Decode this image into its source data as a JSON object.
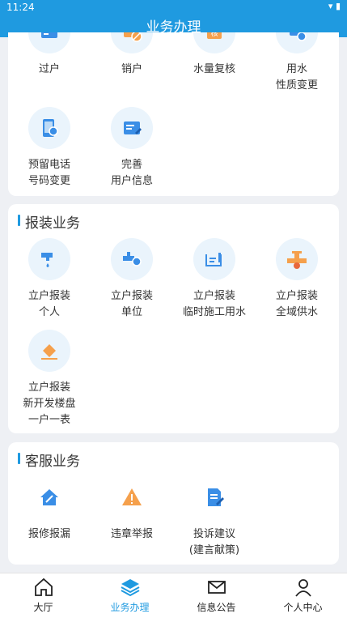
{
  "status_bar": {
    "time": "11:24",
    "wifi_icon": "wifi-icon",
    "battery_icon": "battery-icon"
  },
  "header": {
    "title": "业务办理"
  },
  "account_section": {
    "items": [
      {
        "label": "过户",
        "icon": "card-icon"
      },
      {
        "label": "销户",
        "icon": "cancel-account-icon"
      },
      {
        "label": "水量复核",
        "icon": "review-icon"
      },
      {
        "label": "用水\n性质变更",
        "icon": "tap-change-icon"
      },
      {
        "label": "预留电话\n号码变更",
        "icon": "phone-icon"
      },
      {
        "label": "完善\n用户信息",
        "icon": "user-info-icon"
      }
    ]
  },
  "install_section": {
    "title": "报装业务",
    "items": [
      {
        "label": "立户报装\n个人",
        "icon": "faucet-icon"
      },
      {
        "label": "立户报装\n单位",
        "icon": "pipe-icon"
      },
      {
        "label": "立户报装\n临时施工用水",
        "icon": "construction-icon"
      },
      {
        "label": "立户报装\n全域供水",
        "icon": "valve-icon"
      },
      {
        "label": "立户报装\n新开发楼盘\n一户一表",
        "icon": "edit-building-icon"
      }
    ]
  },
  "service_section": {
    "title": "客服业务",
    "items": [
      {
        "label": "报修报漏",
        "icon": "repair-icon"
      },
      {
        "label": "违章举报",
        "icon": "warning-icon"
      },
      {
        "label": "投诉建议\n(建言献策)",
        "icon": "complaint-icon"
      }
    ]
  },
  "tabbar": {
    "tabs": [
      {
        "label": "大厅",
        "icon": "home-icon",
        "active": false
      },
      {
        "label": "业务办理",
        "icon": "layers-icon",
        "active": true
      },
      {
        "label": "信息公告",
        "icon": "mail-icon",
        "active": false
      },
      {
        "label": "个人中心",
        "icon": "user-icon",
        "active": false
      }
    ]
  },
  "colors": {
    "accent": "#1f9ae0",
    "icon_blue": "#3a8ee6",
    "icon_orange": "#f5a04c",
    "icon_bg": "#eaf4fc"
  }
}
